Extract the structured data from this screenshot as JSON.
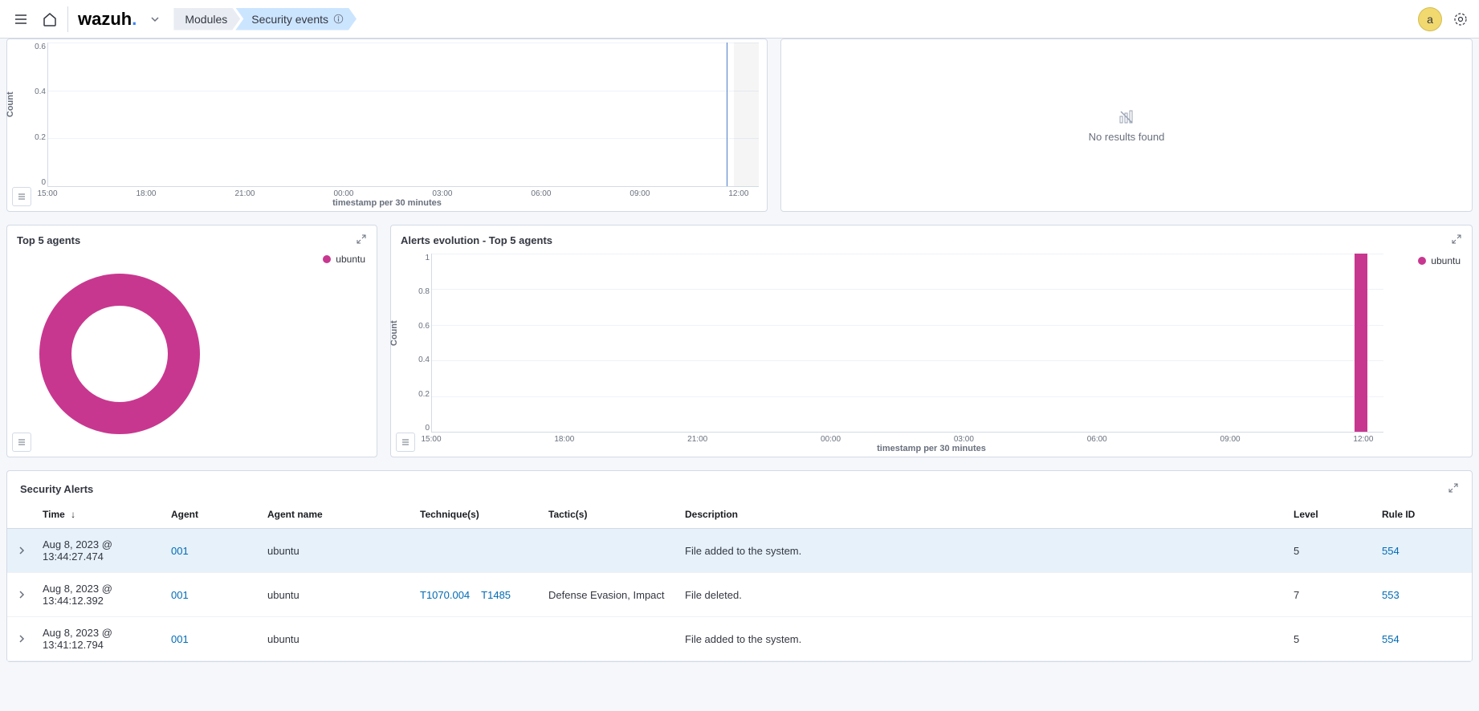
{
  "header": {
    "logo_text": "wazuh",
    "breadcrumb": [
      {
        "label": "Modules",
        "active": false
      },
      {
        "label": "Security events",
        "active": true
      }
    ],
    "avatar_initial": "a"
  },
  "no_results_panel": {
    "message": "No results found"
  },
  "top5_agents_panel": {
    "title": "Top 5 agents",
    "legend_item": "ubuntu",
    "legend_color": "#c8378f"
  },
  "alerts_evolution_panel": {
    "title": "Alerts evolution - Top 5 agents",
    "legend_item": "ubuntu",
    "legend_color": "#c8378f",
    "ylabel": "Count",
    "xlabel": "timestamp per 30 minutes",
    "y_ticks": [
      "1",
      "0.8",
      "0.6",
      "0.4",
      "0.2",
      "0"
    ],
    "x_ticks": [
      "15:00",
      "18:00",
      "21:00",
      "00:00",
      "03:00",
      "06:00",
      "09:00",
      "12:00"
    ]
  },
  "partial_chart": {
    "ylabel": "Count",
    "xlabel": "timestamp per 30 minutes",
    "y_ticks": [
      "0.6",
      "0.4",
      "0.2",
      "0"
    ],
    "x_ticks": [
      "15:00",
      "18:00",
      "21:00",
      "00:00",
      "03:00",
      "06:00",
      "09:00",
      "12:00"
    ]
  },
  "security_alerts": {
    "title": "Security Alerts",
    "columns": {
      "time": "Time",
      "agent": "Agent",
      "agent_name": "Agent name",
      "techniques": "Technique(s)",
      "tactics": "Tactic(s)",
      "description": "Description",
      "level": "Level",
      "rule_id": "Rule ID"
    },
    "rows": [
      {
        "time": "Aug 8, 2023 @ 13:44:27.474",
        "agent": "001",
        "agent_name": "ubuntu",
        "techniques": [],
        "tactics": "",
        "description": "File added to the system.",
        "level": "5",
        "rule_id": "554",
        "highlight": true
      },
      {
        "time": "Aug 8, 2023 @ 13:44:12.392",
        "agent": "001",
        "agent_name": "ubuntu",
        "techniques": [
          "T1070.004",
          "T1485"
        ],
        "tactics": "Defense Evasion, Impact",
        "description": "File deleted.",
        "level": "7",
        "rule_id": "553",
        "highlight": false
      },
      {
        "time": "Aug 8, 2023 @ 13:41:12.794",
        "agent": "001",
        "agent_name": "ubuntu",
        "techniques": [],
        "tactics": "",
        "description": "File added to the system.",
        "level": "5",
        "rule_id": "554",
        "highlight": false
      }
    ]
  },
  "chart_data": [
    {
      "id": "partial-top-chart",
      "type": "bar",
      "title": "",
      "xlabel": "timestamp per 30 minutes",
      "ylabel": "Count",
      "ylim": [
        0,
        0.6
      ],
      "x_ticks": [
        "15:00",
        "18:00",
        "21:00",
        "00:00",
        "03:00",
        "06:00",
        "09:00",
        "12:00"
      ],
      "note": "top portion cropped; single thin bar near 13:30 touching visible top",
      "series": [
        {
          "name": "count",
          "color": "#4a7cc9",
          "points": [
            {
              "x": "13:30",
              "y": 1
            }
          ]
        }
      ]
    },
    {
      "id": "top-5-agents-donut",
      "type": "pie",
      "title": "Top 5 agents",
      "series": [
        {
          "name": "ubuntu",
          "value": 100,
          "color": "#c8378f"
        }
      ]
    },
    {
      "id": "alerts-evolution-top-5-agents",
      "type": "bar",
      "title": "Alerts evolution - Top 5 agents",
      "xlabel": "timestamp per 30 minutes",
      "ylabel": "Count",
      "ylim": [
        0,
        1
      ],
      "x_ticks": [
        "15:00",
        "18:00",
        "21:00",
        "00:00",
        "03:00",
        "06:00",
        "09:00",
        "12:00"
      ],
      "series": [
        {
          "name": "ubuntu",
          "color": "#c8378f",
          "points": [
            {
              "x": "13:30",
              "y": 1
            }
          ]
        }
      ]
    }
  ]
}
